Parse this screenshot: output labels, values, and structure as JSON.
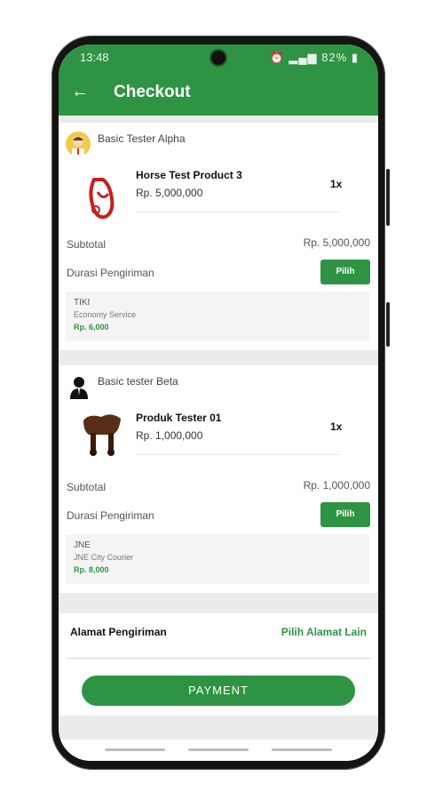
{
  "status": {
    "time": "13:48",
    "battery": "82%"
  },
  "header": {
    "title": "Checkout"
  },
  "stores": [
    {
      "seller": "Basic Tester Alpha",
      "product": "Horse Test Product 3",
      "price": "Rp. 5,000,000",
      "qty": "1x",
      "subtotal_label": "Subtotal",
      "subtotal": "Rp. 5,000,000",
      "duration_label": "Durasi Pengiriman",
      "pick_label": "Pilih",
      "courier": "TIKI",
      "service": "Economy Service",
      "ship_price": "Rp. 6,000"
    },
    {
      "seller": "Basic tester Beta",
      "product": "Produk Tester 01",
      "price": "Rp. 1,000,000",
      "qty": "1x",
      "subtotal_label": "Subtotal",
      "subtotal": "Rp. 1,000,000",
      "duration_label": "Durasi Pengiriman",
      "pick_label": "Pilih",
      "courier": "JNE",
      "service": "JNE City Courier",
      "ship_price": "Rp. 8,000"
    }
  ],
  "address": {
    "label": "Alamat Pengiriman",
    "action": "Pilih Alamat Lain"
  },
  "payment": {
    "label": "PAYMENT"
  },
  "colors": {
    "primary": "#2e9443",
    "background": "#ebebeb"
  },
  "icons": [
    "back-arrow-icon",
    "alarm-icon",
    "signal-icon",
    "battery-icon",
    "avatar-icon",
    "person-icon"
  ]
}
